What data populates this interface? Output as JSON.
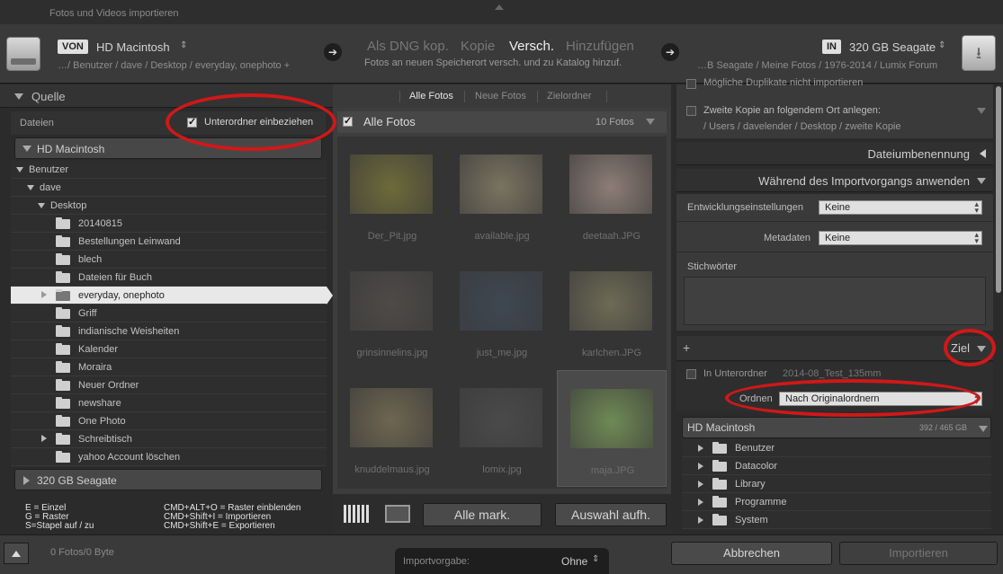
{
  "window": {
    "title": "Fotos und Videos importieren"
  },
  "header": {
    "source_pill": "VON",
    "source_name": "HD Macintosh",
    "source_path": "…/ Benutzer / dave / Desktop / everyday, onephoto +",
    "modes": [
      "Als DNG kop.",
      "Kopie",
      "Versch.",
      "Hinzufügen"
    ],
    "active_mode_index": 2,
    "mode_description": "Fotos an neuen Speicherort versch. und zu Katalog hinzuf.",
    "dest_pill": "IN",
    "dest_name": "320 GB Seagate",
    "dest_path": "…B Seagate / Meine Fotos / 1976-2014 / Lumix Forum"
  },
  "left_panel": {
    "title": "Quelle",
    "files_label": "Dateien",
    "include_subfolders_label": "Unterordner einbeziehen",
    "include_subfolders_checked": true,
    "volume_1": "HD Macintosh",
    "tree": [
      {
        "label": "Benutzer",
        "type": "node-open"
      },
      {
        "label": "dave",
        "type": "node-open"
      },
      {
        "label": "Desktop",
        "type": "node-open"
      },
      {
        "label": "20140815",
        "type": "folder"
      },
      {
        "label": "Bestellungen Leinwand",
        "type": "folder"
      },
      {
        "label": "blech",
        "type": "folder"
      },
      {
        "label": "Dateien für Buch",
        "type": "folder"
      },
      {
        "label": "everyday, onephoto",
        "type": "folder-selected"
      },
      {
        "label": "Griff",
        "type": "folder"
      },
      {
        "label": "indianische Weisheiten",
        "type": "folder"
      },
      {
        "label": "Kalender",
        "type": "folder"
      },
      {
        "label": "Moraira",
        "type": "folder"
      },
      {
        "label": "Neuer Ordner",
        "type": "folder"
      },
      {
        "label": "newshare",
        "type": "folder"
      },
      {
        "label": "One Photo",
        "type": "folder"
      },
      {
        "label": "Schreibtisch",
        "type": "folder-collapsed"
      },
      {
        "label": "yahoo Account löschen",
        "type": "folder"
      }
    ],
    "volume_2": "320 GB Seagate",
    "shortcuts_left": [
      "E = Einzel",
      "G = Raster",
      "S=Stapel auf / zu"
    ],
    "shortcuts_right": [
      "CMD+ALT+O = Raster einblenden",
      "CMD+Shift+I = Importieren",
      "CMD+Shift+E = Exportieren"
    ]
  },
  "center": {
    "tabs": [
      "Alle Fotos",
      "Neue Fotos",
      "Zielordner"
    ],
    "active_tab_index": 0,
    "all_label": "Alle Fotos",
    "count": "10 Fotos",
    "photos": [
      {
        "name": "Der_Pit.jpg",
        "color": "#6e6a3a"
      },
      {
        "name": "available.jpg",
        "color": "#7a7360"
      },
      {
        "name": "deetaah.JPG",
        "color": "#8d7d76"
      },
      {
        "name": "grinsinnelins.jpg",
        "color": "#4e4a48"
      },
      {
        "name": "just_me.jpg",
        "color": "#3e4752"
      },
      {
        "name": "karlchen.JPG",
        "color": "#6d6a55"
      },
      {
        "name": "knuddelmaus.jpg",
        "color": "#6e6650"
      },
      {
        "name": "lomix.jpg",
        "color": "#4a4a4a"
      },
      {
        "name": "maja.JPG",
        "color": "#6f8a55"
      }
    ],
    "selected_photo_index": 8,
    "btn_check_all": "Alle mark.",
    "btn_uncheck_all": "Auswahl aufh."
  },
  "right_panel": {
    "top_cut_label": "Mögliche Duplikate nicht importieren",
    "second_copy_label": "Zweite Kopie an folgendem Ort anlegen:",
    "second_copy_path": "/ Users / davelender / Desktop / zweite Kopie",
    "section_rename": "Dateiumbenennung",
    "section_apply": "Während des Importvorgangs anwenden",
    "develop_label": "Entwicklungseinstellungen",
    "develop_value": "Keine",
    "metadata_label": "Metadaten",
    "metadata_value": "Keine",
    "keywords_label": "Stichwörter",
    "plus_label": "+",
    "section_dest": "Ziel",
    "subfolder_label": "In Unterordner",
    "subfolder_value": "2014-08_Test_135mm",
    "organize_label": "Ordnen",
    "organize_value": "Nach Originalordnern",
    "dest_volume": "HD Macintosh",
    "dest_volume_size": "392 / 465 GB",
    "dest_tree": [
      "Benutzer",
      "Datacolor",
      "Library",
      "Programme",
      "System"
    ]
  },
  "footer": {
    "status": "0 Fotos/0 Byte",
    "preset_label": "Importvorgabe:",
    "preset_value": "Ohne",
    "cancel": "Abbrechen",
    "import": "Importieren"
  },
  "colors": {
    "annotation": "#d01818",
    "selection": "#e8e8e8"
  }
}
